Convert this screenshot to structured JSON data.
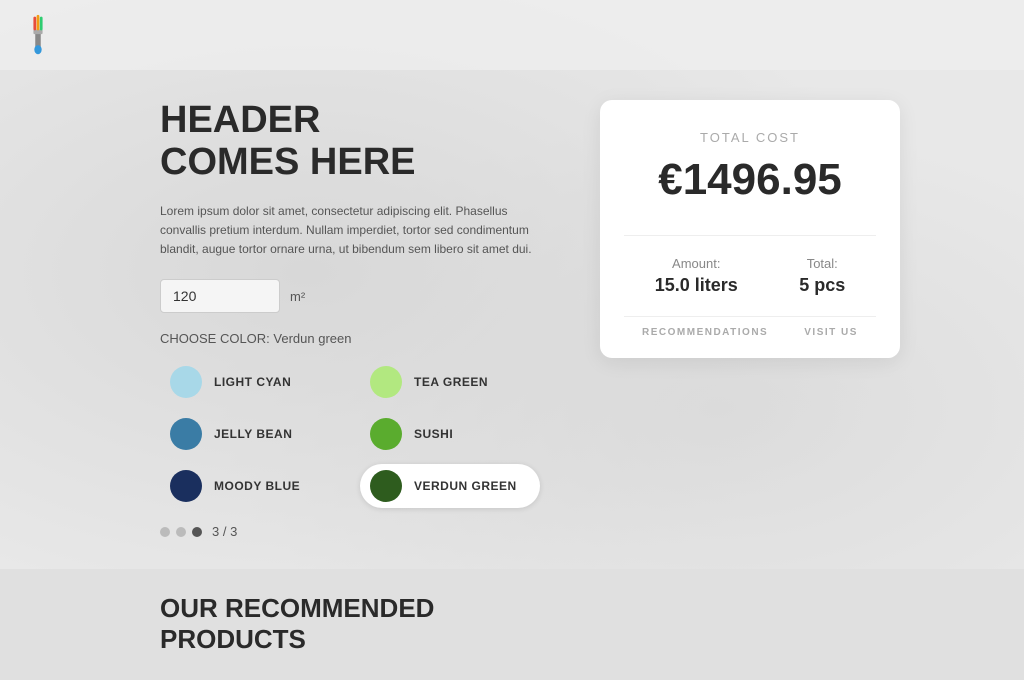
{
  "topbar": {
    "logo_alt": "Paint App Logo"
  },
  "header": {
    "title_line1": "HEADER",
    "title_line2": "COMES HERE",
    "description": "Lorem ipsum dolor sit amet, consectetur adipiscing elit. Phasellus convallis pretium interdum. Nullam imperdiet, tortor sed condimentum blandit, augue tortor ornare urna, ut bibendum sem libero sit amet dui."
  },
  "area_input": {
    "value": "120",
    "unit": "m²"
  },
  "color_selector": {
    "label": "CHOOSE COLOR:",
    "selected_name": "Verdun green",
    "colors": [
      {
        "id": "light-cyan",
        "name": "LIGHT CYAN",
        "hex": "#a8d8e8",
        "active": false
      },
      {
        "id": "tea-green",
        "name": "TEA GREEN",
        "hex": "#b2e8b0",
        "active": false
      },
      {
        "id": "jelly-bean",
        "name": "JELLY BEAN",
        "hex": "#3a7ca5",
        "active": false
      },
      {
        "id": "sushi",
        "name": "SUSHI",
        "hex": "#5aac2e",
        "active": false
      },
      {
        "id": "moody-blue",
        "name": "MOODY BLUE",
        "hex": "#1a2f5e",
        "active": false
      },
      {
        "id": "verdun-green",
        "name": "VERDUN GREEN",
        "hex": "#2e5c1e",
        "active": true
      }
    ]
  },
  "pagination": {
    "current": 3,
    "total": 3,
    "label": "3 / 3"
  },
  "cost_card": {
    "label": "TOTAL COST",
    "value": "€1496.95",
    "amount_label": "Amount:",
    "amount_value": "15.0 liters",
    "total_label": "Total:",
    "total_value": "5 pcs",
    "link1": "RECOMMENDATIONS",
    "link2": "VISIT US"
  },
  "bottom": {
    "header_line1": "OUR RECOMMENDED",
    "header_line2": "PRODUCTS"
  }
}
